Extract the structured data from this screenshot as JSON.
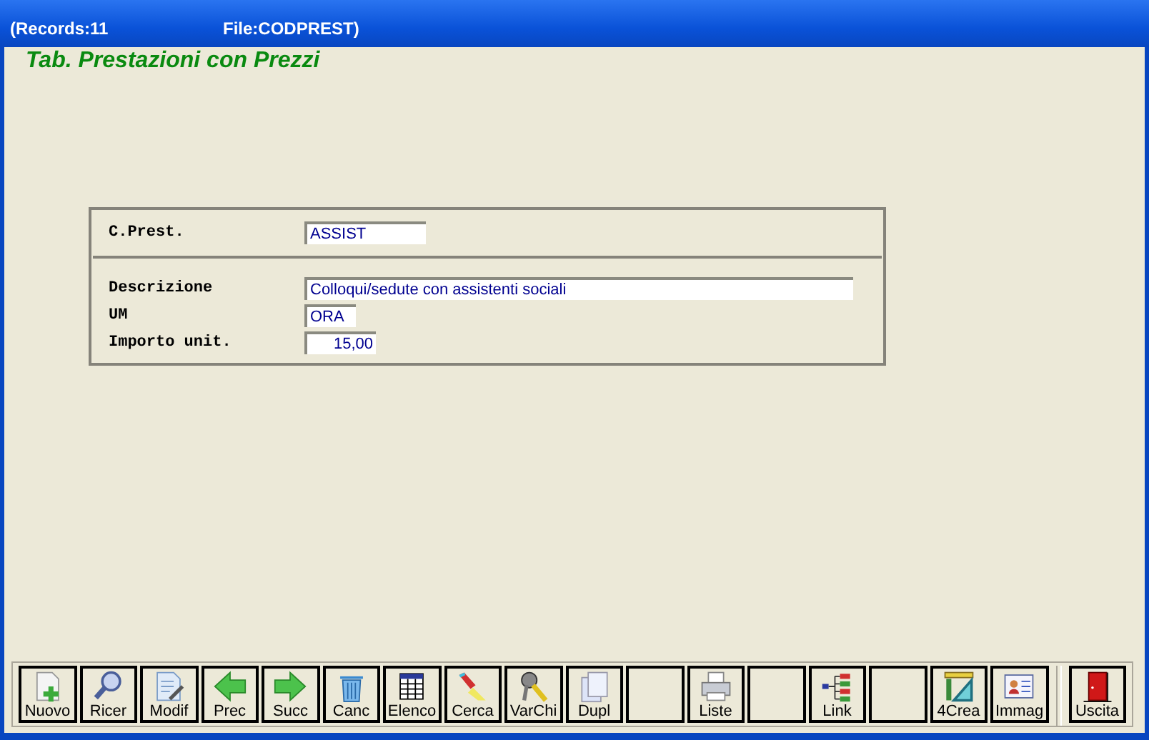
{
  "title_bar": {
    "records": "(Records:11",
    "file": "File:CODPREST)"
  },
  "heading": "Tab. Prestazioni con Prezzi",
  "form": {
    "sections": [
      {
        "fields": [
          {
            "kind": "text",
            "label": "C.Prest.",
            "value": "ASSIST"
          }
        ]
      },
      {
        "fields": [
          {
            "kind": "text",
            "label": "Descrizione",
            "value": "Colloqui/sedute con assistenti sociali"
          },
          {
            "kind": "text",
            "label": "UM",
            "value": "ORA"
          },
          {
            "kind": "number",
            "label": "Importo unit.",
            "value": "15,00"
          }
        ]
      }
    ]
  },
  "toolbar": [
    {
      "kind": "new",
      "label": "Nuovo"
    },
    {
      "kind": "search",
      "label": "Ricer"
    },
    {
      "kind": "edit",
      "label": "Modif"
    },
    {
      "kind": "prev",
      "label": "Prec"
    },
    {
      "kind": "next",
      "label": "Succ"
    },
    {
      "kind": "delete",
      "label": "Canc"
    },
    {
      "kind": "list",
      "label": "Elenco"
    },
    {
      "kind": "find",
      "label": "Cerca"
    },
    {
      "kind": "keys",
      "label": "VarChi"
    },
    {
      "kind": "copy",
      "label": "Dupl"
    },
    {
      "kind": "blank"
    },
    {
      "kind": "print",
      "label": "Liste"
    },
    {
      "kind": "blank"
    },
    {
      "kind": "link",
      "label": "Link"
    },
    {
      "kind": "blank"
    },
    {
      "kind": "create",
      "label": "4Crea"
    },
    {
      "kind": "card",
      "label": "Immag"
    },
    {
      "kind": "exit",
      "label": "Uscita"
    }
  ]
}
